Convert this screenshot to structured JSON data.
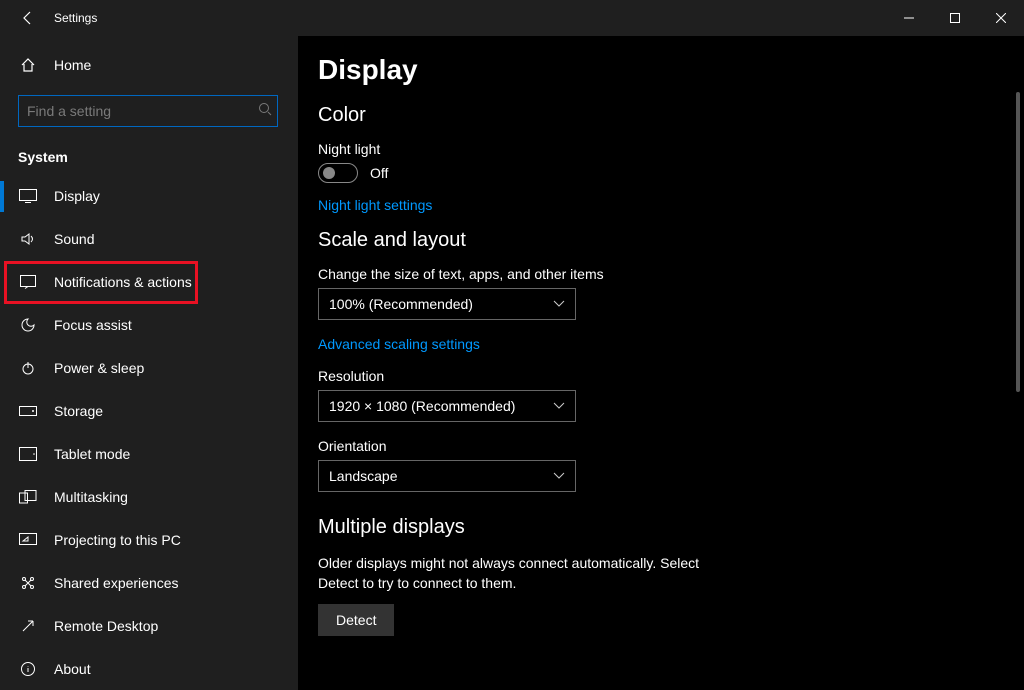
{
  "window": {
    "title": "Settings"
  },
  "sidebar": {
    "home": "Home",
    "search_placeholder": "Find a setting",
    "section": "System",
    "items": [
      {
        "label": "Display"
      },
      {
        "label": "Sound"
      },
      {
        "label": "Notifications & actions"
      },
      {
        "label": "Focus assist"
      },
      {
        "label": "Power & sleep"
      },
      {
        "label": "Storage"
      },
      {
        "label": "Tablet mode"
      },
      {
        "label": "Multitasking"
      },
      {
        "label": "Projecting to this PC"
      },
      {
        "label": "Shared experiences"
      },
      {
        "label": "Remote Desktop"
      },
      {
        "label": "About"
      }
    ]
  },
  "main": {
    "title": "Display",
    "color_heading": "Color",
    "night_light_label": "Night light",
    "night_light_state": "Off",
    "night_light_link": "Night light settings",
    "scale_heading": "Scale and layout",
    "scale_label": "Change the size of text, apps, and other items",
    "scale_value": "100% (Recommended)",
    "advanced_scaling_link": "Advanced scaling settings",
    "resolution_label": "Resolution",
    "resolution_value": "1920 × 1080 (Recommended)",
    "orientation_label": "Orientation",
    "orientation_value": "Landscape",
    "multiple_heading": "Multiple displays",
    "multiple_desc": "Older displays might not always connect automatically. Select Detect to try to connect to them.",
    "detect_button": "Detect"
  }
}
